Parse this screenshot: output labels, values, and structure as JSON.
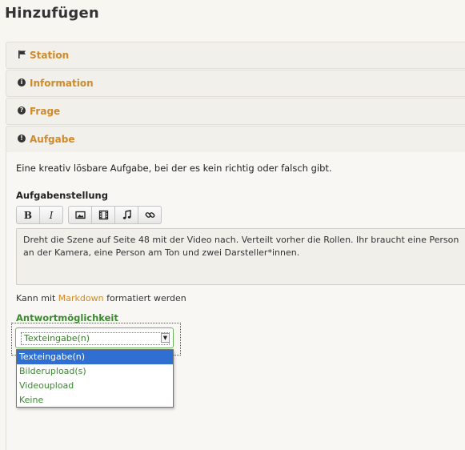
{
  "page": {
    "title": "Hinzufügen"
  },
  "panels": [
    {
      "label": "Station",
      "icon": "flag-icon"
    },
    {
      "label": "Information",
      "icon": "info-icon"
    },
    {
      "label": "Frage",
      "icon": "question-icon"
    },
    {
      "label": "Aufgabe",
      "icon": "exclamation-icon"
    }
  ],
  "task": {
    "description": "Eine kreativ lösbare Aufgabe, bei der es kein richtig oder falsch gibt.",
    "field_label": "Aufgabenstellung",
    "toolbar": {
      "bold": "B",
      "italic": "I",
      "image_icon": "image-icon",
      "video_icon": "film-icon",
      "audio_icon": "music-icon",
      "link_icon": "link-icon"
    },
    "text": "Dreht die Szene auf Seite 48 mit der Video nach. Verteilt vorher die Rollen. Ihr braucht eine Person an der Kamera, eine Person am Ton und zwei Darsteller*innen.",
    "hint_prefix": "Kann mit ",
    "hint_link": "Markdown",
    "hint_suffix": " formatiert werden",
    "answer_label": "Antwortmöglichkeit",
    "answer_selected": "Texteingabe(n)",
    "answer_options": [
      "Texteingabe(n)",
      "Bilderupload(s)",
      "Videoupload",
      "Keine"
    ]
  },
  "colors": {
    "accent": "#d08a2b",
    "green": "#3a8a2e",
    "selected": "#2f6fd1"
  }
}
